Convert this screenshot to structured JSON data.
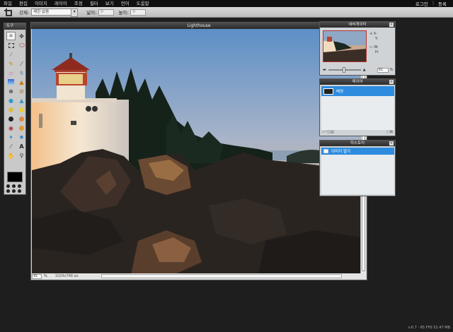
{
  "menubar": {
    "items": [
      "파일",
      "편집",
      "이미지",
      "레이어",
      "조정",
      "필터",
      "보기",
      "언어",
      "도움말"
    ],
    "login": "로그인",
    "separator": "|",
    "register": "등록"
  },
  "optbar": {
    "ratio_label": "강제:",
    "ratio_value": "제한 없음",
    "width_label": "넓이:",
    "width_value": "0",
    "height_label": "높이:",
    "height_value": "0"
  },
  "tools": {
    "title": "도구",
    "foreground_color": "#000000"
  },
  "document": {
    "title": "Lighthouse",
    "zoom": "91",
    "zoom_unit": "%",
    "dimensions": "1024x768 px"
  },
  "navigator": {
    "title": "네비게이터",
    "x_label": "X:",
    "y_label": "Y:",
    "w_label": "W:",
    "h_label": "H:",
    "zoom": "91",
    "zoom_unit": "%"
  },
  "layers": {
    "title": "레이어",
    "items": [
      {
        "name": "배경"
      }
    ]
  },
  "history": {
    "title": "히스토리",
    "items": [
      {
        "name": "이미지 열기"
      }
    ]
  },
  "footer": {
    "version": "v.6.7 - 65 FPS 52.47 MB"
  },
  "colors": {
    "accent": "#2e8ce0",
    "panel_bg": "#cfd3d6",
    "titlebar": "#333333"
  }
}
